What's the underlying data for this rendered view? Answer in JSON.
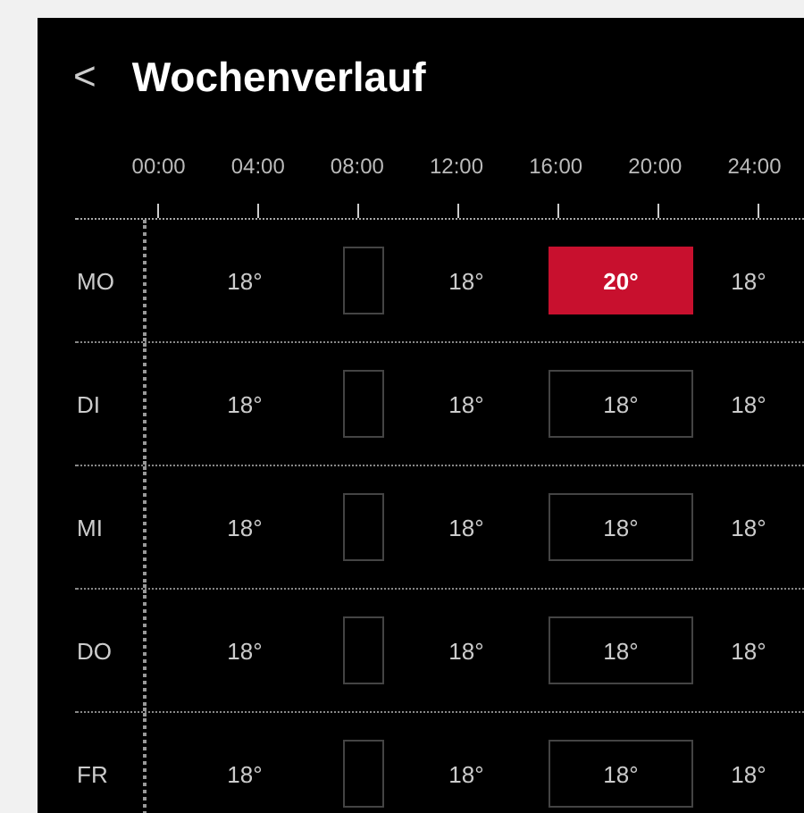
{
  "header": {
    "back": "<",
    "title": "Wochenverlauf"
  },
  "timeline": {
    "hours": [
      "00:00",
      "04:00",
      "08:00",
      "12:00",
      "16:00",
      "20:00",
      "24:00"
    ]
  },
  "days": [
    {
      "label": "MO",
      "segments": [
        {
          "kind": "plain",
          "text": "18°"
        },
        {
          "kind": "slot",
          "active": false
        },
        {
          "kind": "plain",
          "text": "18°"
        },
        {
          "kind": "slot",
          "active": true,
          "text": "20°"
        },
        {
          "kind": "plain",
          "text": "18°"
        }
      ]
    },
    {
      "label": "DI",
      "segments": [
        {
          "kind": "plain",
          "text": "18°"
        },
        {
          "kind": "slot",
          "active": false
        },
        {
          "kind": "plain",
          "text": "18°"
        },
        {
          "kind": "slot",
          "active": false,
          "text": "18°"
        },
        {
          "kind": "plain",
          "text": "18°"
        }
      ]
    },
    {
      "label": "MI",
      "segments": [
        {
          "kind": "plain",
          "text": "18°"
        },
        {
          "kind": "slot",
          "active": false
        },
        {
          "kind": "plain",
          "text": "18°"
        },
        {
          "kind": "slot",
          "active": false,
          "text": "18°"
        },
        {
          "kind": "plain",
          "text": "18°"
        }
      ]
    },
    {
      "label": "DO",
      "segments": [
        {
          "kind": "plain",
          "text": "18°"
        },
        {
          "kind": "slot",
          "active": false
        },
        {
          "kind": "plain",
          "text": "18°"
        },
        {
          "kind": "slot",
          "active": false,
          "text": "18°"
        },
        {
          "kind": "plain",
          "text": "18°"
        }
      ]
    },
    {
      "label": "FR",
      "segments": [
        {
          "kind": "plain",
          "text": "18°"
        },
        {
          "kind": "slot",
          "active": false
        },
        {
          "kind": "plain",
          "text": "18°"
        },
        {
          "kind": "slot",
          "active": false,
          "text": "18°"
        },
        {
          "kind": "plain",
          "text": "18°"
        }
      ]
    }
  ]
}
